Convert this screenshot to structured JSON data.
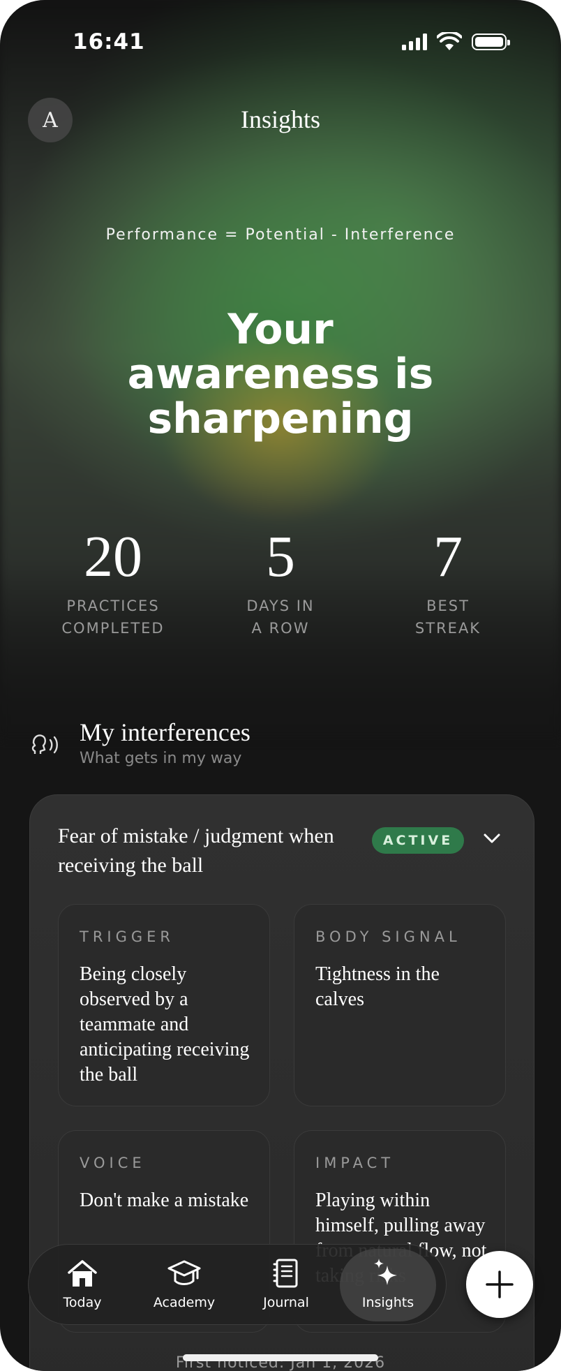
{
  "status_bar": {
    "time": "16:41"
  },
  "header": {
    "avatar_initial": "A",
    "title": "Insights"
  },
  "hero": {
    "formula": "Performance = Potential - Interference",
    "headline_lines": [
      "Your",
      "awareness is",
      "sharpening"
    ]
  },
  "stats": [
    {
      "value": "20",
      "label_line1": "PRACTICES",
      "label_line2": "COMPLETED"
    },
    {
      "value": "5",
      "label_line1": "DAYS IN",
      "label_line2": "A ROW"
    },
    {
      "value": "7",
      "label_line1": "BEST",
      "label_line2": "STREAK"
    }
  ],
  "section": {
    "title": "My interferences",
    "subtitle": "What gets in my way",
    "icon": "speaking-head-icon"
  },
  "interference_card": {
    "title": "Fear of mistake / judgment when receiving the ball",
    "badge": "ACTIVE",
    "tiles": {
      "trigger": {
        "label": "TRIGGER",
        "value": "Being closely observed by a teammate and anticipating receiving the ball"
      },
      "body_signal": {
        "label": "BODY SIGNAL",
        "value": "Tightness in the calves"
      },
      "voice": {
        "label": "VOICE",
        "value": "Don't make a mistake"
      },
      "impact": {
        "label": "IMPACT",
        "value": "Playing within himself, pulling away from natural flow, not taking risks"
      }
    },
    "first_noticed": "First noticed: Jan 1, 2026"
  },
  "tab_bar": {
    "tabs": [
      {
        "label": "Today",
        "icon": "home-icon"
      },
      {
        "label": "Academy",
        "icon": "graduation-cap-icon"
      },
      {
        "label": "Journal",
        "icon": "journal-icon"
      },
      {
        "label": "Insights",
        "icon": "sparkles-icon",
        "active": true
      }
    ],
    "fab_icon": "plus-icon"
  },
  "colors": {
    "accent_green": "#2f7a4a",
    "background": "#151515",
    "card": "#2d2d2d"
  }
}
